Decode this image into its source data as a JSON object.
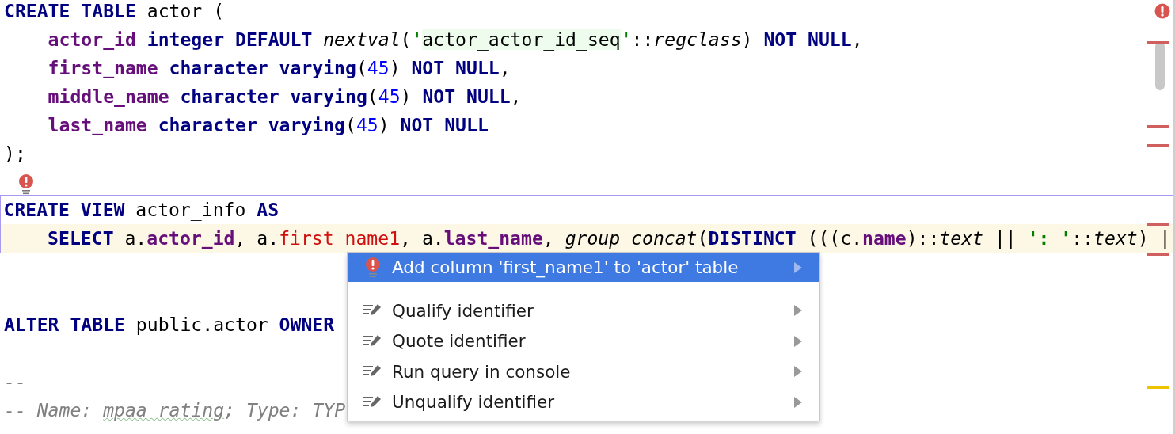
{
  "editor": {
    "blocks": [
      {
        "outlined": false,
        "lines": [
          {
            "current": false,
            "tokens": [
              {
                "t": "CREATE TABLE",
                "kind": "kw"
              },
              {
                "t": " actor (",
                "kind": "plain"
              }
            ]
          },
          {
            "current": false,
            "tokens": [
              {
                "t": "    actor_id ",
                "kind": "col"
              },
              {
                "t": "integer DEFAULT ",
                "kind": "kw"
              },
              {
                "t": "nextval",
                "kind": "fn"
              },
              {
                "t": "(",
                "kind": "plain"
              },
              {
                "t": "'",
                "kind": "str"
              },
              {
                "t": "actor_actor_id_seq",
                "kind": "inj"
              },
              {
                "t": "'",
                "kind": "str"
              },
              {
                "t": "::",
                "kind": "plain"
              },
              {
                "t": "regclass",
                "kind": "fn"
              },
              {
                "t": ") ",
                "kind": "plain"
              },
              {
                "t": "NOT NULL",
                "kind": "kw"
              },
              {
                "t": ",",
                "kind": "plain"
              }
            ]
          },
          {
            "current": false,
            "tokens": [
              {
                "t": "    first_name ",
                "kind": "col"
              },
              {
                "t": "character varying",
                "kind": "kw"
              },
              {
                "t": "(",
                "kind": "plain"
              },
              {
                "t": "45",
                "kind": "num"
              },
              {
                "t": ") ",
                "kind": "plain"
              },
              {
                "t": "NOT NULL",
                "kind": "kw"
              },
              {
                "t": ",",
                "kind": "plain"
              }
            ]
          },
          {
            "current": false,
            "tokens": [
              {
                "t": "    middle_name ",
                "kind": "col"
              },
              {
                "t": "character varying",
                "kind": "kw"
              },
              {
                "t": "(",
                "kind": "plain"
              },
              {
                "t": "45",
                "kind": "num"
              },
              {
                "t": ") ",
                "kind": "plain"
              },
              {
                "t": "NOT NULL",
                "kind": "kw"
              },
              {
                "t": ",",
                "kind": "plain"
              }
            ]
          },
          {
            "current": false,
            "tokens": [
              {
                "t": "    last_name ",
                "kind": "col"
              },
              {
                "t": "character varying",
                "kind": "kw"
              },
              {
                "t": "(",
                "kind": "plain"
              },
              {
                "t": "45",
                "kind": "num"
              },
              {
                "t": ") ",
                "kind": "plain"
              },
              {
                "t": "NOT NULL",
                "kind": "kw"
              }
            ]
          },
          {
            "current": false,
            "tokens": [
              {
                "t": ");",
                "kind": "plain"
              }
            ]
          },
          {
            "current": false
          }
        ]
      },
      {
        "outlined": true,
        "lines": [
          {
            "current": false,
            "tokens": [
              {
                "t": "CREATE VIEW",
                "kind": "kw"
              },
              {
                "t": " actor_info ",
                "kind": "plain"
              },
              {
                "t": "AS",
                "kind": "kw"
              }
            ]
          },
          {
            "current": true,
            "tokens": [
              {
                "t": "    SELECT",
                "kind": "kw"
              },
              {
                "t": " a.",
                "kind": "plain"
              },
              {
                "t": "actor_id",
                "kind": "col"
              },
              {
                "t": ", a.",
                "kind": "plain"
              },
              {
                "t": "first_name1",
                "kind": "err"
              },
              {
                "t": ", a.",
                "kind": "plain"
              },
              {
                "t": "last_name",
                "kind": "col"
              },
              {
                "t": ", ",
                "kind": "plain"
              },
              {
                "t": "group_concat",
                "kind": "fn"
              },
              {
                "t": "(",
                "kind": "plain"
              },
              {
                "t": "DISTINCT",
                "kind": "kw"
              },
              {
                "t": " (((c.",
                "kind": "plain"
              },
              {
                "t": "name",
                "kind": "col"
              },
              {
                "t": ")::",
                "kind": "plain"
              },
              {
                "t": "text",
                "kind": "fn"
              },
              {
                "t": " || ",
                "kind": "plain"
              },
              {
                "t": "': '",
                "kind": "str"
              },
              {
                "t": "::",
                "kind": "plain"
              },
              {
                "t": "text",
                "kind": "fn"
              },
              {
                "t": ") |",
                "kind": "plain"
              }
            ]
          }
        ]
      },
      {
        "outlined": false,
        "lines": [
          {
            "current": false
          },
          {
            "current": false
          },
          {
            "current": false,
            "tokens": [
              {
                "t": "ALTER TABLE",
                "kind": "kw"
              },
              {
                "t": " public.actor ",
                "kind": "plain"
              },
              {
                "t": "OWNER",
                "kind": "kw"
              }
            ]
          },
          {
            "current": false
          },
          {
            "current": false,
            "tokens": [
              {
                "t": "--",
                "kind": "comment"
              }
            ]
          },
          {
            "current": false,
            "tokens": [
              {
                "t": "-- Name: ",
                "kind": "comment"
              },
              {
                "t": "mpaa_rating",
                "kind": "typo"
              },
              {
                "t": "; Type: TYP",
                "kind": "comment"
              }
            ]
          }
        ]
      }
    ]
  },
  "menu": {
    "items": [
      {
        "label": "Add column 'first_name1' to 'actor' table",
        "kind": "error",
        "selected": true
      },
      {
        "label": "Qualify identifier",
        "kind": "intention",
        "selected": false
      },
      {
        "label": "Quote identifier",
        "kind": "intention",
        "selected": false
      },
      {
        "label": "Run query in console",
        "kind": "intention",
        "selected": false
      },
      {
        "label": "Unqualify identifier",
        "kind": "intention",
        "selected": false
      }
    ]
  },
  "marker_stripe": {
    "marks": [
      {
        "kind": "error"
      },
      {
        "kind": "error"
      },
      {
        "kind": "error"
      },
      {
        "kind": "error"
      },
      {
        "kind": "error"
      },
      {
        "kind": "warning"
      }
    ]
  }
}
